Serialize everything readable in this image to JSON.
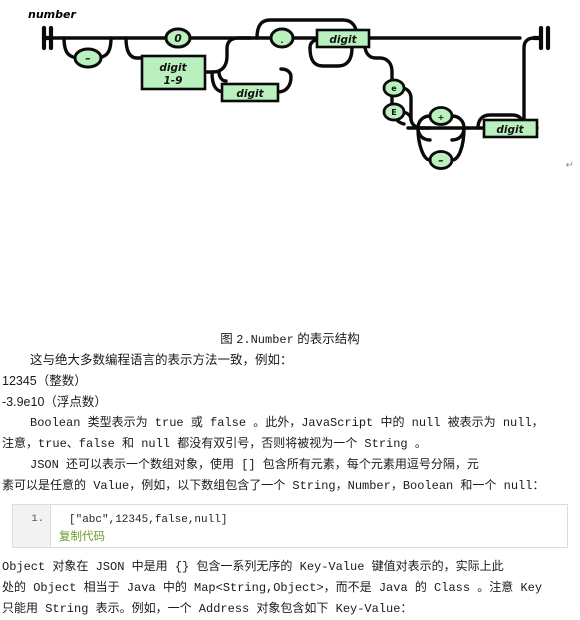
{
  "diagram": {
    "title": "number",
    "terminals": {
      "minus_sign": "–",
      "zero": "0",
      "digit": "digit",
      "digit_one_nine_line1": "digit",
      "digit_one_nine_line2": "1-9",
      "dot": ".",
      "e_lower": "e",
      "e_upper": "E",
      "plus_sign": "+",
      "minus_exp": "–"
    },
    "colors": {
      "terminal_fill": "#b9f0bd",
      "stroke": "#0a0a0a",
      "background": "#ffffff"
    },
    "paragraph_mark": "↵"
  },
  "caption": {
    "prefix": "图 ",
    "figure_number": "2.Number",
    "suffix": " 的表示结构"
  },
  "body": {
    "p_intro": "这与绝大多数编程语言的表示方法一致，例如：",
    "example_int": "12345（整数）",
    "example_float": "-3.9e10（浮点数）",
    "p_boolean_1": "Boolean 类型表示为 true 或 false 。此外，JavaScript 中的 null 被表示为 null，",
    "p_boolean_2": "注意，true、false 和 null 都没有双引号，否则将被视为一个 String 。",
    "p_json_1": "JSON 还可以表示一个数组对象，使用 [] 包含所有元素，每个元素用逗号分隔，元",
    "p_json_2": "素可以是任意的 Value，例如，以下数组包含了一个 String，Number，Boolean 和一个 null：",
    "p_object_1": "Object 对象在 JSON 中是用 {} 包含一系列无序的 Key-Value 键值对表示的，实际上此",
    "p_object_2": "处的 Object 相当于 Java 中的 Map<String,Object>，而不是 Java 的 Class 。注意 Key",
    "p_object_3": "只能用 String 表示。例如，一个 Address 对象包含如下 Key-Value："
  },
  "code_block": {
    "line_number": "1.",
    "code": "[\"abc\",12345,false,null]",
    "copy_label": "复制代码",
    "copy_color": "#6e9a28"
  }
}
